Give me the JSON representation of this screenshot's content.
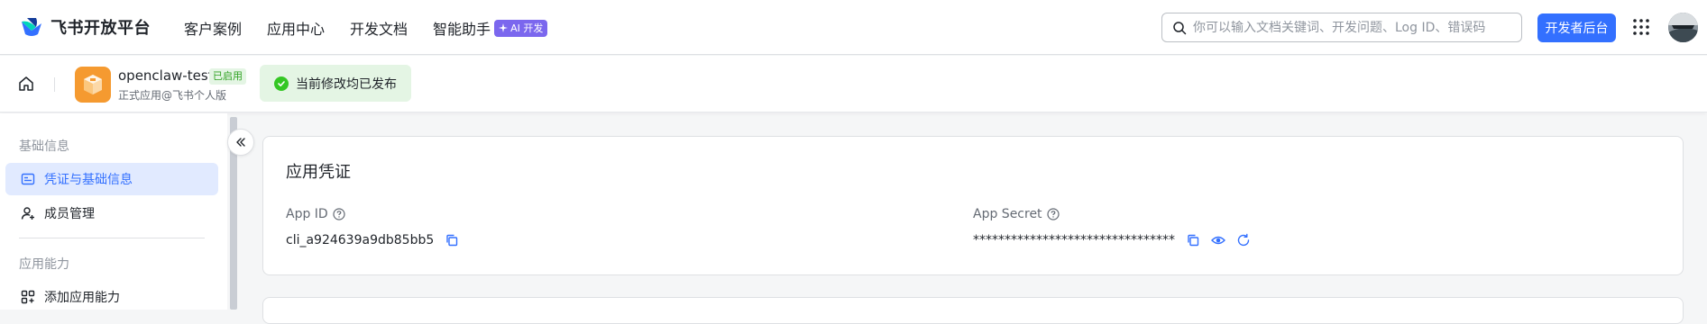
{
  "header": {
    "brand": "飞书开放平台",
    "nav": [
      "客户案例",
      "应用中心",
      "开发文档",
      "智能助手"
    ],
    "ai_badge": "AI 开发",
    "search_placeholder": "你可以输入文档关键词、开发问题、Log ID、错误码",
    "dev_console_button": "开发者后台"
  },
  "app": {
    "name": "openclaw-test",
    "status": "已启用",
    "subtitle": "正式应用@飞书个人版",
    "publish_status": "当前修改均已发布",
    "icon_color": "#f59a30"
  },
  "sidebar": {
    "groups": [
      {
        "title": "基础信息",
        "items": [
          "凭证与基础信息",
          "成员管理"
        ]
      },
      {
        "title": "应用能力",
        "items": [
          "添加应用能力"
        ]
      }
    ],
    "active_item": "凭证与基础信息"
  },
  "credentials": {
    "title": "应用凭证",
    "app_id_label": "App ID",
    "app_id_value": "cli_a924639a9db85bb5",
    "app_secret_label": "App Secret",
    "app_secret_value": "********************************"
  },
  "colors": {
    "accent": "#3370ff",
    "success": "#34c724",
    "ai_badge": "#7b67ee"
  }
}
